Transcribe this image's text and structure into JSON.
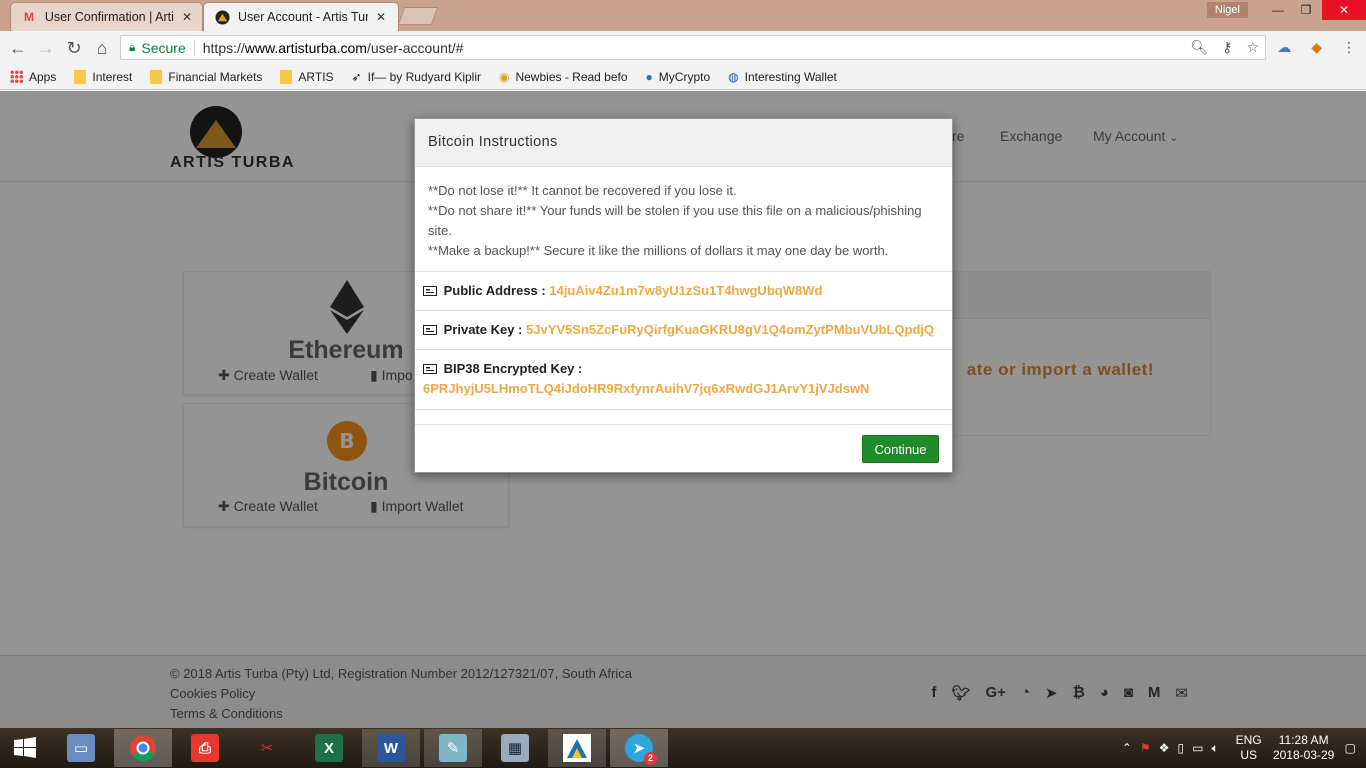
{
  "browser": {
    "tabs": [
      {
        "title": "User Confirmation | Artis",
        "favicon": "gmail-icon"
      },
      {
        "title": "User Account - Artis Turb",
        "favicon": "artis-icon"
      }
    ],
    "user_badge": "Nigel",
    "secure_label": "Secure",
    "url_scheme": "https://",
    "url_host": "www.artisturba.com",
    "url_path": "/user-account/#"
  },
  "bookmarks": [
    {
      "label": "Apps",
      "icon": "apps-grid-icon"
    },
    {
      "label": "Interest",
      "icon": "folder-icon"
    },
    {
      "label": "Financial Markets",
      "icon": "folder-icon"
    },
    {
      "label": "ARTIS",
      "icon": "folder-icon"
    },
    {
      "label": "If— by Rudyard Kiplir",
      "icon": "bird-icon"
    },
    {
      "label": "Newbies - Read befo",
      "icon": "coin-icon"
    },
    {
      "label": "MyCrypto",
      "icon": "mycrypto-icon"
    },
    {
      "label": "Interesting Wallet",
      "icon": "globe-icon"
    }
  ],
  "site": {
    "logo_word1": "ARTIS",
    "logo_word2": "TURBA",
    "nav": {
      "partial": "re",
      "exchange": "Exchange",
      "account": "My Account"
    },
    "ethereum_card": {
      "title": "Ethereum",
      "create": "Create Wallet",
      "import": "Impo"
    },
    "bitcoin_card": {
      "title": "Bitcoin",
      "create": "Create Wallet",
      "import": "Import Wallet"
    },
    "panel_message": "ate or import a wallet!"
  },
  "footer": {
    "copyright": "© 2018 Artis Turba (Pty) Ltd, Registration Number 2012/127321/07, South Africa",
    "cookies": "Cookies Policy",
    "terms": "Terms & Conditions",
    "socials": [
      "facebook",
      "twitter",
      "google-plus",
      "github",
      "telegram",
      "bitcoin",
      "reddit",
      "instagram",
      "medium",
      "email"
    ]
  },
  "modal": {
    "title": "Bitcoin Instructions",
    "line1": "**Do not lose it!** It cannot be recovered if you lose it.",
    "line2": "**Do not share it!** Your funds will be stolen if you use this file on a malicious/phishing site.",
    "line3": "**Make a backup!** Secure it like the millions of dollars it may one day be worth.",
    "public_address_label": "Public Address :",
    "public_address": "14juAiv4Zu1m7w8yU1zSu1T4hwgUbqW8Wd",
    "private_key_label": "Private Key :",
    "private_key": "5JvYV5Sn5ZcFuRyQirfgKuaGKRU8gV1Q4omZytPMbuVUbLQpdjQ",
    "bip38_label": "BIP38 Encrypted Key :",
    "bip38": "6PRJhyjU5LHmoTLQ4iJdoHR9RxfynrAuihV7jq6xRwdGJ1ArvY1jVJdswN",
    "continue": "Continue"
  },
  "taskbar": {
    "lang": "ENG",
    "region": "US",
    "time": "11:28 AM",
    "date": "2018-03-29",
    "telegram_badge": "2"
  }
}
